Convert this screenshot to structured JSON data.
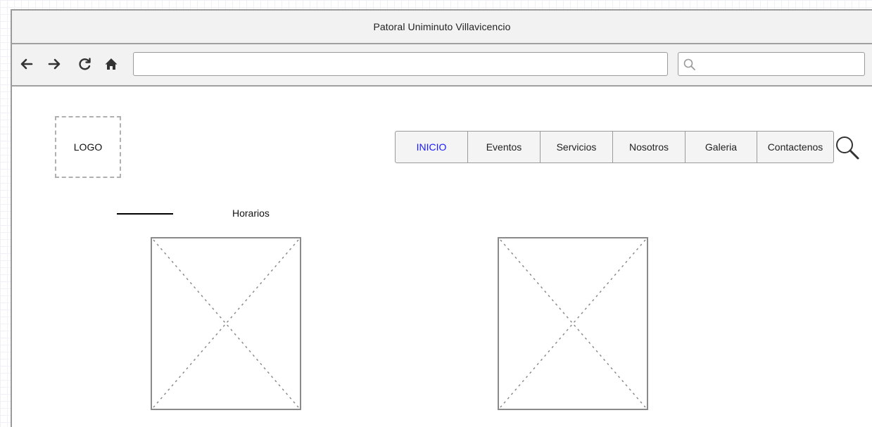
{
  "window": {
    "title": "Patoral Uniminuto Villavicencio"
  },
  "toolbar": {
    "back_icon": "arrow-left-icon",
    "forward_icon": "arrow-right-icon",
    "reload_icon": "reload-icon",
    "home_icon": "home-icon",
    "address_value": "",
    "search_value": "",
    "search_icon": "search-icon"
  },
  "page": {
    "logo_label": "LOGO",
    "menu": [
      {
        "label": "INICIO",
        "active": true
      },
      {
        "label": "Eventos",
        "active": false
      },
      {
        "label": "Servicios",
        "active": false
      },
      {
        "label": "Nosotros",
        "active": false
      },
      {
        "label": "Galeria",
        "active": false
      },
      {
        "label": "Contactenos",
        "active": false
      }
    ],
    "menu_search_icon": "search-icon",
    "section_label": "Horarios",
    "image_placeholders": 2,
    "active_color": "#1a1aff"
  }
}
